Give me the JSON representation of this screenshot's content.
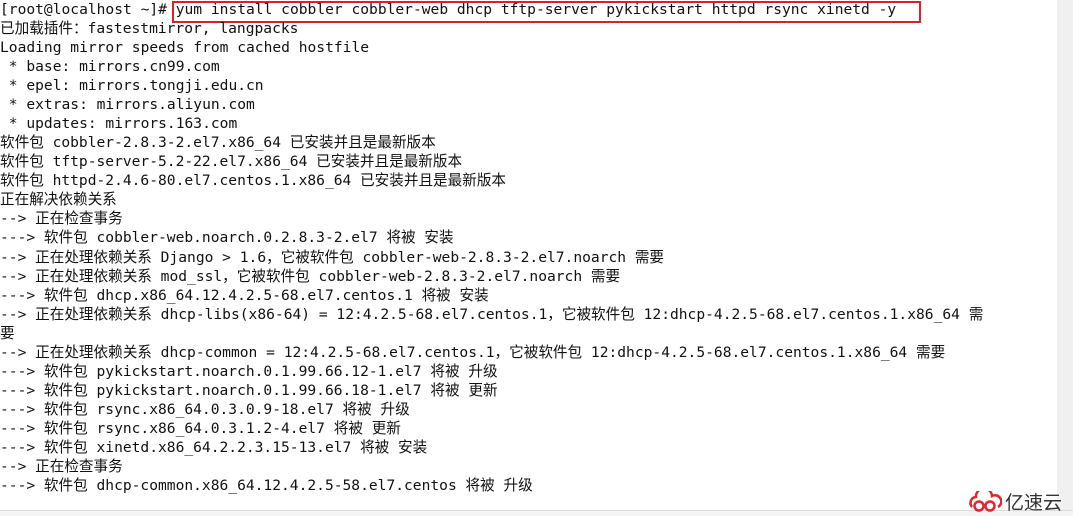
{
  "terminal": {
    "prompt": "[root@localhost ~]# ",
    "command": "yum install cobbler cobbler-web dhcp tftp-server pykickstart httpd rsync xinetd -y",
    "highlight_color": "#d9202c",
    "lines": [
      "已加载插件：fastestmirror, langpacks",
      "Loading mirror speeds from cached hostfile",
      " * base: mirrors.cn99.com",
      " * epel: mirrors.tongji.edu.cn",
      " * extras: mirrors.aliyun.com",
      " * updates: mirrors.163.com",
      "软件包 cobbler-2.8.3-2.el7.x86_64 已安装并且是最新版本",
      "软件包 tftp-server-5.2-22.el7.x86_64 已安装并且是最新版本",
      "软件包 httpd-2.4.6-80.el7.centos.1.x86_64 已安装并且是最新版本",
      "正在解决依赖关系",
      "--> 正在检查事务",
      "---> 软件包 cobbler-web.noarch.0.2.8.3-2.el7 将被 安装",
      "--> 正在处理依赖关系 Django > 1.6，它被软件包 cobbler-web-2.8.3-2.el7.noarch 需要",
      "--> 正在处理依赖关系 mod_ssl，它被软件包 cobbler-web-2.8.3-2.el7.noarch 需要",
      "---> 软件包 dhcp.x86_64.12.4.2.5-68.el7.centos.1 将被 安装",
      "--> 正在处理依赖关系 dhcp-libs(x86-64) = 12:4.2.5-68.el7.centos.1，它被软件包 12:dhcp-4.2.5-68.el7.centos.1.x86_64 需",
      "要",
      "--> 正在处理依赖关系 dhcp-common = 12:4.2.5-68.el7.centos.1，它被软件包 12:dhcp-4.2.5-68.el7.centos.1.x86_64 需要",
      "---> 软件包 pykickstart.noarch.0.1.99.66.12-1.el7 将被 升级",
      "---> 软件包 pykickstart.noarch.0.1.99.66.18-1.el7 将被 更新",
      "---> 软件包 rsync.x86_64.0.3.0.9-18.el7 将被 升级",
      "---> 软件包 rsync.x86_64.0.3.1.2-4.el7 将被 更新",
      "---> 软件包 xinetd.x86_64.2.2.3.15-13.el7 将被 安装",
      "--> 正在检查事务",
      "---> 软件包 dhcp-common.x86_64.12.4.2.5-58.el7.centos 将被 升级"
    ]
  },
  "watermark": {
    "text": "亿速云",
    "icon": "cloud-logo-icon",
    "color": "#e0262f"
  }
}
